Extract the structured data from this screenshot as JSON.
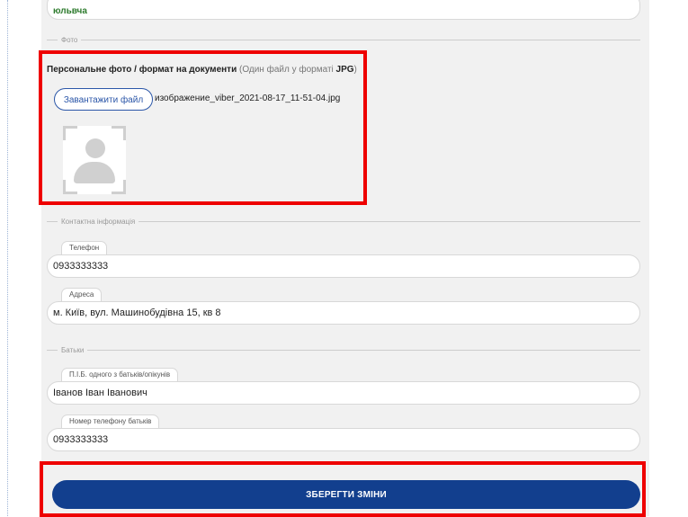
{
  "top_field": {
    "value": "юльвча"
  },
  "sections": {
    "photo": {
      "legend": "Фото",
      "title_bold": "Персональне фото / формат на документи",
      "title_hint_prefix": " (Один файл у форматі ",
      "title_hint_format": "JPG",
      "title_hint_suffix": ")",
      "upload_label": "Завантажити файл",
      "filename": "изображение_viber_2021-08-17_11-51-04.jpg",
      "avatar_icon": "user-placeholder-icon"
    },
    "contact": {
      "legend": "Контактна інформація",
      "phone_label": "Телефон",
      "phone_value": "0933333333",
      "address_label": "Адреса",
      "address_value": "м. Київ, вул. Машинобудівна 15, кв 8"
    },
    "parents": {
      "legend": "Батьки",
      "parent_name_label": "П.І.Б. одного з батьків/опікунів",
      "parent_name_value": "Іванов Іван Іванович",
      "parent_phone_label": "Номер телефону батьків",
      "parent_phone_value": "0933333333"
    }
  },
  "save_button": {
    "label": "ЗБЕРЕГТИ ЗМІНИ"
  },
  "colors": {
    "accent": "#123f8e",
    "highlight": "#ee0000",
    "panel_bg": "#f1f1f1"
  }
}
